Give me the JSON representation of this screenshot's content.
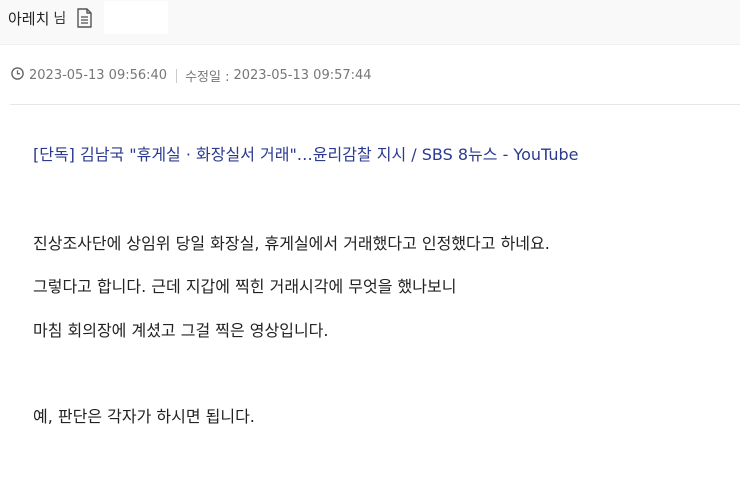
{
  "header": {
    "author_name": "아레치",
    "author_suffix": "님",
    "document_icon": "document-icon"
  },
  "meta": {
    "clock_icon": "clock-icon",
    "created": "2023-05-13 09:56:40",
    "modified_label": "수정일 :",
    "modified": "2023-05-13 09:57:44"
  },
  "post": {
    "link_text": "[단독] 김남국 \"휴게실 · 화장실서 거래\"…윤리감찰 지시 / SBS 8뉴스 - YouTube",
    "paragraphs": [
      "진상조사단에 상임위 당일 화장실, 휴게실에서 거래했다고 인정했다고 하네요.",
      "그렇다고 합니다. 근데 지갑에 찍힌 거래시각에 무엇을 했나보니",
      "마침 회의장에 계셨고 그걸 찍은 영상입니다.",
      "예, 판단은 각자가 하시면 됩니다."
    ]
  },
  "colors": {
    "link": "#2b3a8f",
    "meta_text": "#777777",
    "header_bg": "#f9f9f9"
  }
}
